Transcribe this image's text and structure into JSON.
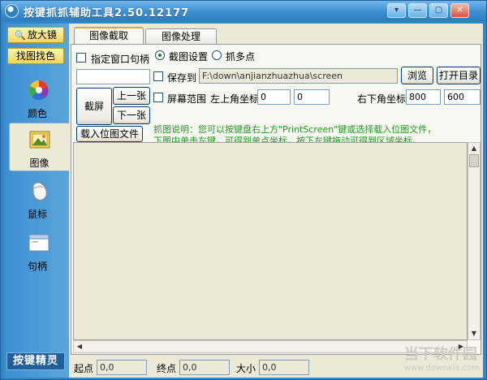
{
  "window": {
    "title": "按键抓抓辅助工具2.50.12177",
    "controls": [
      "▾",
      "—",
      "▢",
      "✕"
    ]
  },
  "sidebar": {
    "magnifier_label": "放大镜",
    "find_image_label": "找图找色",
    "items": [
      {
        "label": "颜色",
        "icon": "color-wheel-icon"
      },
      {
        "label": "图像",
        "icon": "image-icon"
      },
      {
        "label": "鼠标",
        "icon": "mouse-icon"
      },
      {
        "label": "句柄",
        "icon": "window-handle-icon"
      }
    ],
    "brand": "按键精灵"
  },
  "tabs": [
    {
      "label": "图像截取",
      "active": true
    },
    {
      "label": "图像处理",
      "active": false
    }
  ],
  "capture": {
    "window_handle_label": "指定窗口句柄",
    "handle_value": "",
    "capture_settings_label": "截图设置",
    "pick_points_label": "抓多点",
    "save_to_label": "保存到",
    "save_path": "F:\\down\\anjianzhuazhua\\screen",
    "browse_label": "浏览",
    "open_dir_label": "打开目录",
    "capture_button": "截屏",
    "prev_button": "上一张",
    "next_button": "下一张",
    "screen_range_label": "屏幕范围",
    "top_left_label": "左上角坐标",
    "top_left_x": "0",
    "top_left_y": "0",
    "bottom_right_label": "右下角坐标",
    "bottom_right_x": "800",
    "bottom_right_y": "600",
    "load_bitmap_button": "载入位图文件",
    "hint_line1": "抓图说明：您可以按键盘右上方\"PrintScreen\"键或选择载入位图文件，",
    "hint_line2": "下图中单击左键，可得到单点坐标，按下左键拖动可得到区域坐标。"
  },
  "status": {
    "start_label": "起点",
    "start_value": "0,0",
    "end_label": "终点",
    "end_value": "0,0",
    "size_label": "大小",
    "size_value": "0,0"
  },
  "watermark": {
    "text": "当下软件园",
    "url": "www.downxia.com"
  },
  "colors": {
    "titlebar": "#3c8fd2",
    "sidebar": "#4a9ad6",
    "panel": "#ece9d8",
    "hint_text": "#1a9a1a",
    "tab_accent": "#e9a33a"
  }
}
